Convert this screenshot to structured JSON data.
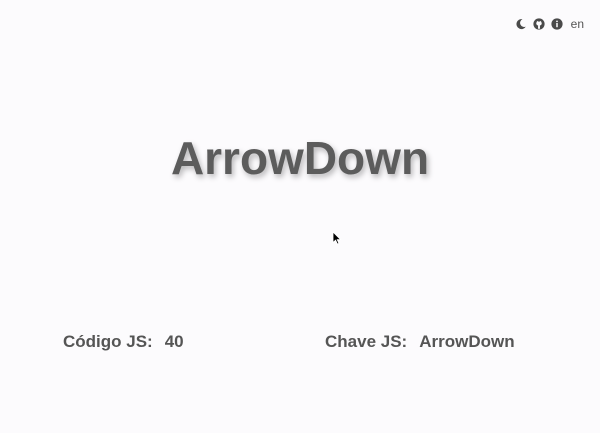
{
  "toolbar": {
    "icons": [
      "moon-icon",
      "github-icon",
      "info-icon"
    ],
    "language": "en"
  },
  "main": {
    "key_display": "ArrowDown"
  },
  "details": {
    "code_label": "Código JS:",
    "code_value": "40",
    "key_label": "Chave JS:",
    "key_value": "ArrowDown"
  },
  "colors": {
    "background": "#fcfbfd",
    "text": "#5a5a5a"
  }
}
